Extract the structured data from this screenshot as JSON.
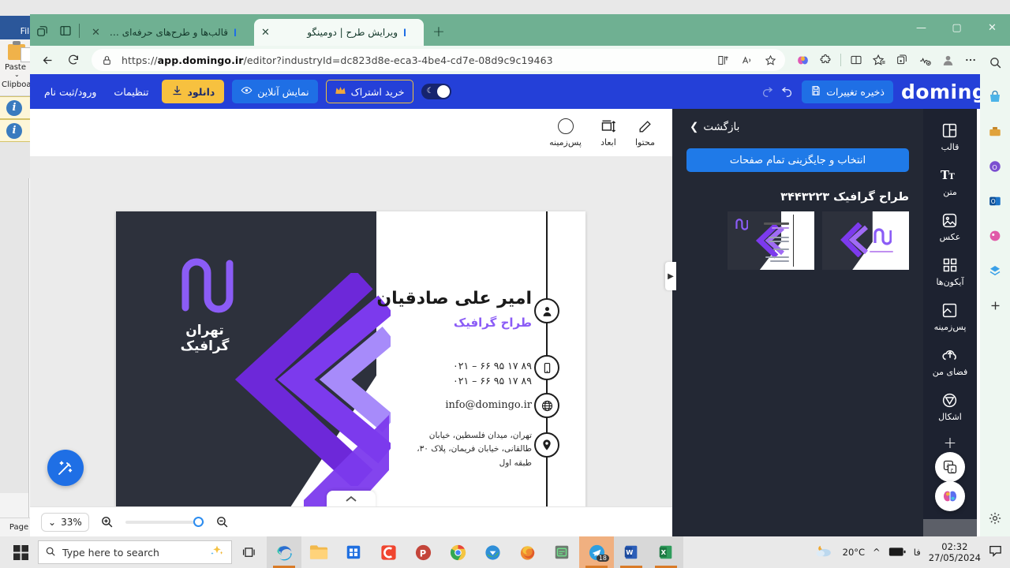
{
  "background_app": {
    "file_menu": "File",
    "paste_label": "Paste",
    "clipboard_label": "Clipboard",
    "status_label": "Page"
  },
  "browser": {
    "tabs": [
      {
        "title": "قالب‌ها و طرح‌های حرفه‌ای و رایگان",
        "favicon": "domingo-d-icon",
        "active": false,
        "close": "✕"
      },
      {
        "title": "ویرایش طرح | دومینگو",
        "favicon": "domingo-d-icon",
        "active": true,
        "close": "✕"
      }
    ],
    "new_tab": "+",
    "tab_actions": {
      "copilot": "tab-copilot-icon",
      "tab_list": "tab-list-icon"
    },
    "window_controls": {
      "minimize": "—",
      "maximize": "▢",
      "close": "✕"
    },
    "nav": {
      "back": "←",
      "refresh": "⟳"
    },
    "address": {
      "lock": "lock-icon",
      "url_prefix": "https://",
      "url_bold": "app.domingo.ir",
      "url_rest": "/editor?industryId=dc823d8e-eca3-4be4-cd7e-08d9c9c19463",
      "url_full": "https://app.domingo.ir/editor?industryId=dc823d8e-eca3-4be4-cd7e-08d9c9c19463",
      "split_screen": "split-screen-icon",
      "read_aloud": "read-aloud-icon",
      "favorite": "star-icon"
    },
    "toolbar_icons": [
      "copilot-brain-icon",
      "extensions-icon",
      "split-screen-icon",
      "favorites-icon",
      "collections-icon",
      "browser-essentials-icon",
      "profile-icon",
      "settings-more-icon",
      "copilot-icon"
    ]
  },
  "app": {
    "logo": "domingo",
    "save_button": "ذخیره تغییرات",
    "undo": "undo-icon",
    "redo": "redo-icon",
    "dark_mode_toggle": "dark-mode-toggle",
    "subscribe_button": "خرید اشتراک",
    "preview_button": "نمایش آنلاین",
    "download_button": "دانلود",
    "settings_link": "تنظیمات",
    "login_link": "ورود/ثبت نام"
  },
  "canvas_tools": [
    {
      "label": "محتوا",
      "icon": "pencil-icon"
    },
    {
      "label": "ابعاد",
      "icon": "dimensions-icon"
    },
    {
      "label": "پس‌زمینه",
      "icon": "background-circle-icon"
    }
  ],
  "card": {
    "logo_name": "تهران گرافیک",
    "name": "امیر علی صادقیان",
    "role": "طراح گرافیک",
    "phone_1": "۰۲۱ – ۶۶ ۹۵ ۱۷ ۸۹",
    "phone_2": "۰۲۱ – ۶۶ ۹۵ ۱۷ ۸۹",
    "email": "info@domingo.ir",
    "address_line1": "تهران، میدان فلسطین، خیابان",
    "address_line2": "طالقانی، خیابان فریمان، پلاک ۳۰،",
    "address_line3": "طبقه اول",
    "icons": [
      "person-icon",
      "phone-icon",
      "globe-icon",
      "location-pin-icon"
    ],
    "accent_color": "#8b5cf6",
    "dark_color": "#2d313c"
  },
  "zoom_bar": {
    "level": "33%",
    "chevron": "⌄",
    "zoom_in": "zoom-in-icon",
    "zoom_out": "zoom-out-icon"
  },
  "magic_button": "magic-wand-icon",
  "flyout_arrow": "▶",
  "panel": {
    "back_label": "بازگشت",
    "back_chevron": "❯",
    "replace_all_button": "انتخاب و جایگزینی تمام صفحات",
    "template_title": "طراح گرافیک ۳۴۴۳۲۲۳",
    "thumbnails": [
      {
        "name": "card-back-thumbnail"
      },
      {
        "name": "card-front-thumbnail"
      }
    ]
  },
  "rail": [
    {
      "label": "قالب",
      "icon": "template-icon"
    },
    {
      "label": "متن",
      "icon": "text-icon"
    },
    {
      "label": "عکس",
      "icon": "image-icon"
    },
    {
      "label": "آیکون‌ها",
      "icon": "icons-grid-icon"
    },
    {
      "label": "پس‌زمینه",
      "icon": "background-icon"
    },
    {
      "label": "فضای من",
      "icon": "cloud-upload-icon"
    },
    {
      "label": "اشکال",
      "icon": "shapes-icon"
    },
    {
      "label": "",
      "icon": "plus-icon"
    }
  ],
  "floating_buttons": [
    {
      "name": "translate-icon"
    },
    {
      "name": "ai-brain-icon"
    }
  ],
  "taskbar": {
    "start": "windows-start-icon",
    "search_placeholder": "Type here to search",
    "search_icon": "search-icon",
    "copilot_sparkle": "sparkle-icon",
    "task_view": "task-view-icon",
    "apps": [
      {
        "name": "edge-icon",
        "active": true
      },
      {
        "name": "file-explorer-icon",
        "active": false
      },
      {
        "name": "microsoft-store-icon",
        "active": false
      },
      {
        "name": "camtasia-icon",
        "active": false
      },
      {
        "name": "powerpoint-alt-icon",
        "active": false
      },
      {
        "name": "chrome-icon",
        "active": false
      },
      {
        "name": "idm-icon",
        "active": false
      },
      {
        "name": "firefox-icon",
        "active": false
      },
      {
        "name": "notepad-icon",
        "active": false
      },
      {
        "name": "telegram-icon",
        "active": true,
        "badge": "18"
      },
      {
        "name": "word-icon",
        "active": true
      },
      {
        "name": "excel-icon",
        "active": true
      }
    ],
    "weather_temp": "20°C",
    "weather_icon": "partly-cloudy-night-icon",
    "tray_chevron": "^",
    "battery": "battery-icon",
    "language": "فا",
    "time": "02:32",
    "date": "27/05/2024",
    "notifications": "notification-icon"
  }
}
